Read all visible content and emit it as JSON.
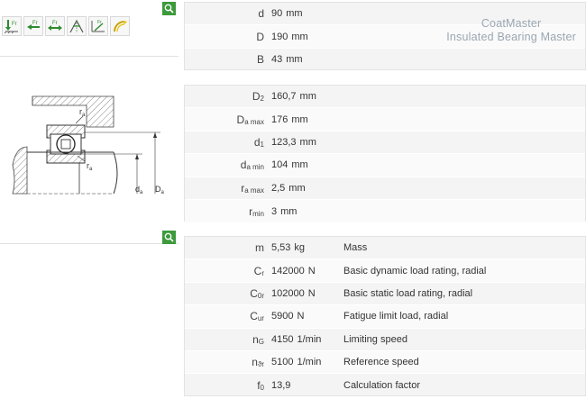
{
  "brand": {
    "line1": "CoatMaster",
    "line2": "Insulated Bearing Master"
  },
  "toolbar": {
    "icons": [
      "radial-load-icon",
      "axial-load-left-icon",
      "axial-load-both-icon",
      "angular-load-icon",
      "misalignment-icon",
      "temperature-icon"
    ],
    "zoom_icon": "magnifier-icon"
  },
  "colors": {
    "accent_green": "#3c9a3c",
    "panel_bg": "#f4f4f4"
  },
  "drawing": {
    "label_ra_top": "r",
    "label_ra_top_sub": "a",
    "label_ra_bottom": "r",
    "label_ra_bottom_sub": "a",
    "label_da": "d",
    "label_da_sub": "a",
    "label_Da": "D",
    "label_Da_sub": "a"
  },
  "dimensions_main": [
    {
      "sym": "d",
      "sub": "",
      "value": "90",
      "unit": "mm"
    },
    {
      "sym": "D",
      "sub": "",
      "value": "190",
      "unit": "mm"
    },
    {
      "sym": "B",
      "sub": "",
      "value": "43",
      "unit": "mm"
    }
  ],
  "dimensions_mount": [
    {
      "sym": "D",
      "sub": "2",
      "value": "160,7",
      "unit": "mm"
    },
    {
      "sym": "D",
      "sub": "a max",
      "value": "176",
      "unit": "mm"
    },
    {
      "sym": "d",
      "sub": "1",
      "value": "123,3",
      "unit": "mm"
    },
    {
      "sym": "d",
      "sub": "a min",
      "value": "104",
      "unit": "mm"
    },
    {
      "sym": "r",
      "sub": "a max",
      "value": "2,5",
      "unit": "mm"
    },
    {
      "sym": "r",
      "sub": "min",
      "value": "3",
      "unit": "mm"
    }
  ],
  "ratings": [
    {
      "sym": "m",
      "sub": "",
      "value": "5,53",
      "unit": "kg",
      "desc": "Mass"
    },
    {
      "sym": "C",
      "sub": "r",
      "value": "142000",
      "unit": "N",
      "desc": "Basic dynamic load rating, radial"
    },
    {
      "sym": "C",
      "sub": "0r",
      "value": "102000",
      "unit": "N",
      "desc": "Basic static load rating, radial"
    },
    {
      "sym": "C",
      "sub": "ur",
      "value": "5900",
      "unit": "N",
      "desc": "Fatigue limit load, radial"
    },
    {
      "sym": "n",
      "sub": "G",
      "value": "4150",
      "unit": "1/min",
      "desc": "Limiting speed"
    },
    {
      "sym": "n",
      "sub": "ϑr",
      "value": "5100",
      "unit": "1/min",
      "desc": "Reference speed"
    },
    {
      "sym": "f",
      "sub": "0",
      "value": "13,9",
      "unit": "",
      "desc": "Calculation factor"
    }
  ]
}
